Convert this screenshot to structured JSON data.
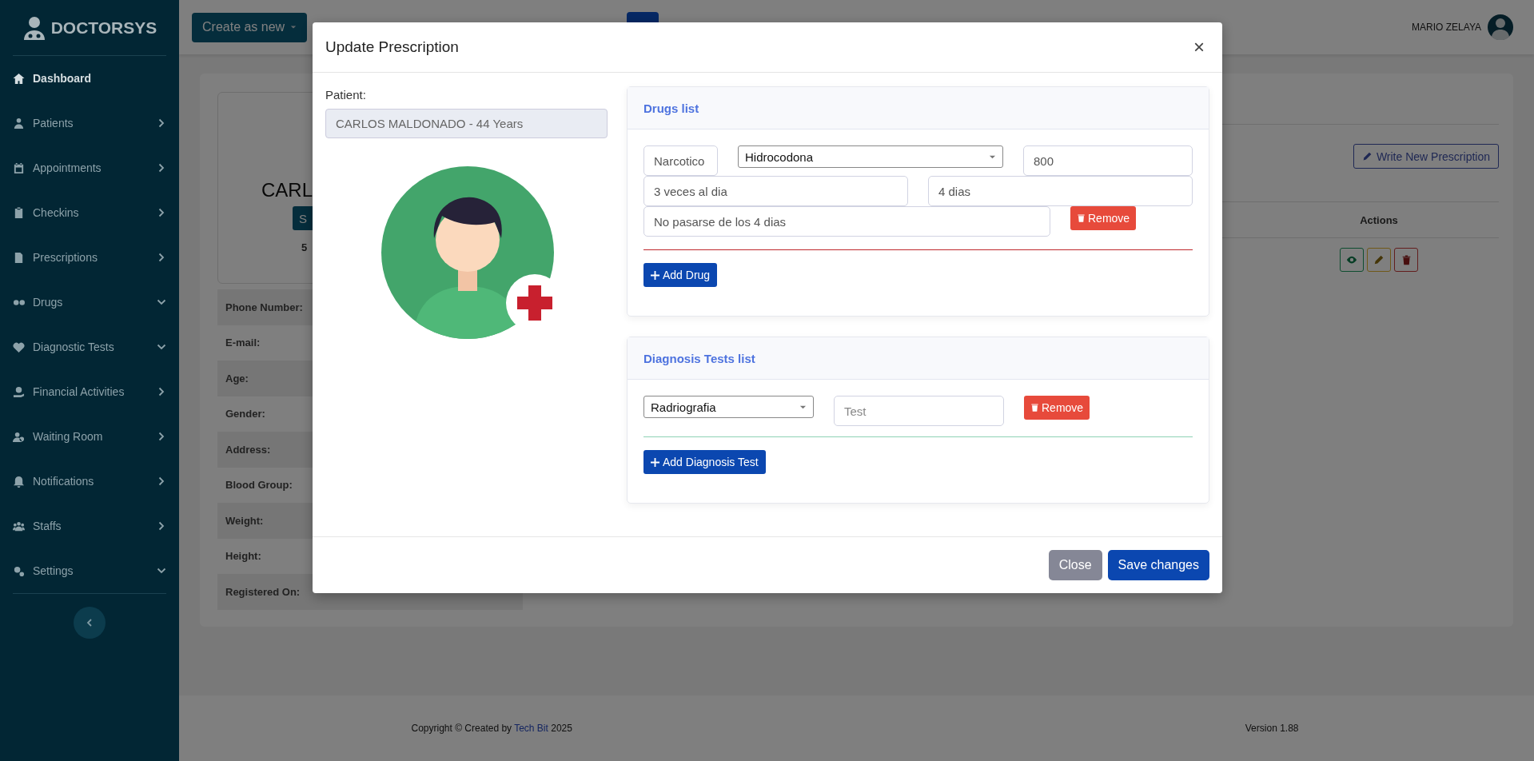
{
  "sidebar": {
    "brand": "DOCTORSYS",
    "items": [
      {
        "label": "Dashboard",
        "kind": "link",
        "selected": true
      },
      {
        "label": "Patients",
        "kind": "menu",
        "selected": false,
        "expanded": false
      },
      {
        "label": "Appointments",
        "kind": "menu",
        "selected": false,
        "expanded": false
      },
      {
        "label": "Checkins",
        "kind": "menu",
        "selected": false,
        "expanded": false
      },
      {
        "label": "Prescriptions",
        "kind": "menu",
        "selected": false,
        "expanded": false
      },
      {
        "label": "Drugs",
        "kind": "menu",
        "selected": false,
        "expanded": true
      },
      {
        "label": "Diagnostic Tests",
        "kind": "menu",
        "selected": false,
        "expanded": true
      },
      {
        "label": "Financial Activities",
        "kind": "menu",
        "selected": false,
        "expanded": false
      },
      {
        "label": "Waiting Room",
        "kind": "menu",
        "selected": false,
        "expanded": false
      },
      {
        "label": "Notifications",
        "kind": "menu",
        "selected": false,
        "expanded": false
      },
      {
        "label": "Staffs",
        "kind": "menu",
        "selected": false,
        "expanded": false
      },
      {
        "label": "Settings",
        "kind": "menu",
        "selected": false,
        "expanded": true
      }
    ]
  },
  "topbar": {
    "create_button": "Create as new",
    "user_name": "MARIO ZELAYA"
  },
  "patient_card": {
    "name": "CARL",
    "button": "S",
    "count": "5"
  },
  "info_rows": [
    "Phone Number:",
    "E-mail:",
    "Age:",
    "Gender:",
    "Address:",
    "Blood Group:",
    "Weight:",
    "Height:",
    "Registered On:"
  ],
  "prescriptions": {
    "write_button": "Write New Prescription",
    "columns": [
      "Actions"
    ]
  },
  "footer": {
    "copyright": "Copyright © Created by",
    "link": "Tech Bit",
    "year": "2025",
    "version": "Version 1.88"
  },
  "modal": {
    "title": "Update Prescription",
    "close_symbol": "×",
    "patient_label": "Patient:",
    "patient": {
      "value": "CARLOS MALDONADO - 44 Years",
      "disabled": true
    },
    "drugs": {
      "title": "Drugs list",
      "rows": [
        {
          "type": "Narcotico",
          "drug": "Hidrocodona",
          "dose": "800",
          "frequency": "3 veces al dia",
          "duration": "4 dias",
          "note": "No pasarse de los 4 dias",
          "remove": "Remove"
        }
      ],
      "add_button": "Add Drug"
    },
    "tests": {
      "title": "Diagnosis Tests list",
      "rows": [
        {
          "test": "Radriografia",
          "placeholder": "Test",
          "remove": "Remove"
        }
      ],
      "add_button": "Add Diagnosis Test"
    },
    "buttons": {
      "close": "Close",
      "save": "Save changes"
    }
  }
}
